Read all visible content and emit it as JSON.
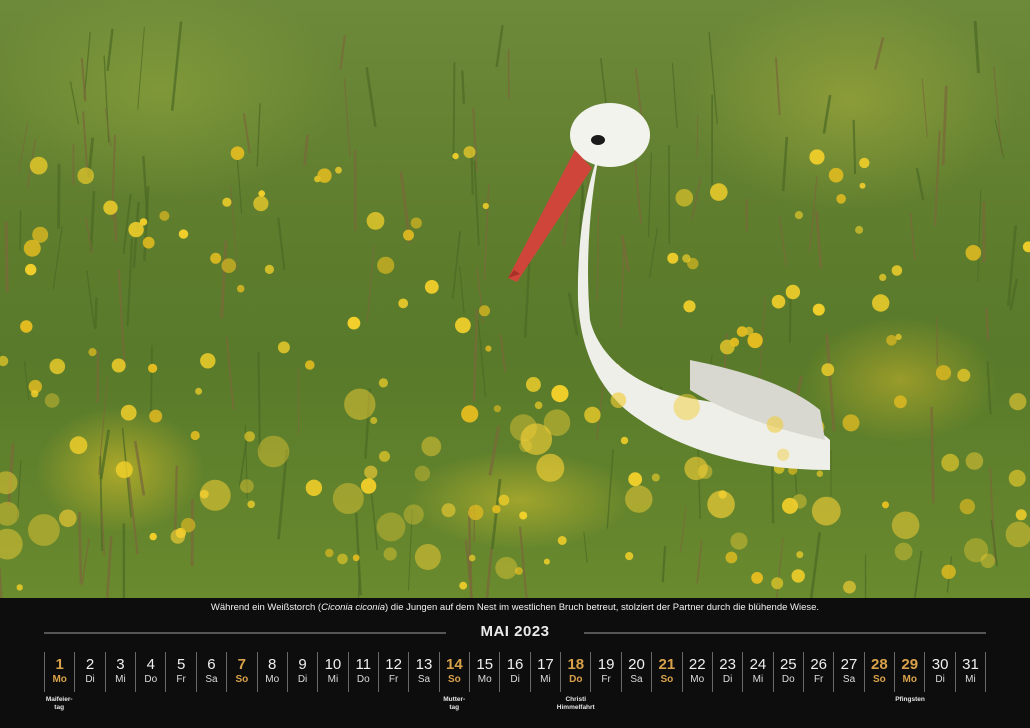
{
  "caption": {
    "before": "Während ein Weißstorch (",
    "scientific": "Ciconia ciconia",
    "after": ") die Jungen auf dem Nest im westlichen Bruch betreut, stolziert der Partner durch die blühende Wiese."
  },
  "month_title": "MAI 2023",
  "colors": {
    "highlight": "#d9a24a",
    "background": "#0d0d0d",
    "text": "#f0f0f0"
  },
  "days": [
    {
      "num": "1",
      "wd": "Mo",
      "hl": true
    },
    {
      "num": "2",
      "wd": "Di",
      "hl": false
    },
    {
      "num": "3",
      "wd": "Mi",
      "hl": false
    },
    {
      "num": "4",
      "wd": "Do",
      "hl": false
    },
    {
      "num": "5",
      "wd": "Fr",
      "hl": false
    },
    {
      "num": "6",
      "wd": "Sa",
      "hl": false
    },
    {
      "num": "7",
      "wd": "So",
      "hl": true
    },
    {
      "num": "8",
      "wd": "Mo",
      "hl": false
    },
    {
      "num": "9",
      "wd": "Di",
      "hl": false
    },
    {
      "num": "10",
      "wd": "Mi",
      "hl": false
    },
    {
      "num": "11",
      "wd": "Do",
      "hl": false
    },
    {
      "num": "12",
      "wd": "Fr",
      "hl": false
    },
    {
      "num": "13",
      "wd": "Sa",
      "hl": false
    },
    {
      "num": "14",
      "wd": "So",
      "hl": true
    },
    {
      "num": "15",
      "wd": "Mo",
      "hl": false
    },
    {
      "num": "16",
      "wd": "Di",
      "hl": false
    },
    {
      "num": "17",
      "wd": "Mi",
      "hl": false
    },
    {
      "num": "18",
      "wd": "Do",
      "hl": true
    },
    {
      "num": "19",
      "wd": "Fr",
      "hl": false
    },
    {
      "num": "20",
      "wd": "Sa",
      "hl": false
    },
    {
      "num": "21",
      "wd": "So",
      "hl": true
    },
    {
      "num": "22",
      "wd": "Mo",
      "hl": false
    },
    {
      "num": "23",
      "wd": "Di",
      "hl": false
    },
    {
      "num": "24",
      "wd": "Mi",
      "hl": false
    },
    {
      "num": "25",
      "wd": "Do",
      "hl": false
    },
    {
      "num": "26",
      "wd": "Fr",
      "hl": false
    },
    {
      "num": "27",
      "wd": "Sa",
      "hl": false
    },
    {
      "num": "28",
      "wd": "So",
      "hl": true
    },
    {
      "num": "29",
      "wd": "Mo",
      "hl": true
    },
    {
      "num": "30",
      "wd": "Di",
      "hl": false
    },
    {
      "num": "31",
      "wd": "Mi",
      "hl": false
    }
  ],
  "holiday_notes": [
    {
      "day": 1,
      "text": "Maifeier-\ntag"
    },
    {
      "day": 14,
      "text": "Mutter-\ntag"
    },
    {
      "day": 18,
      "text": "Christi\nHimmelfahrt"
    },
    {
      "day": 29,
      "text": "Pfingsten"
    }
  ]
}
